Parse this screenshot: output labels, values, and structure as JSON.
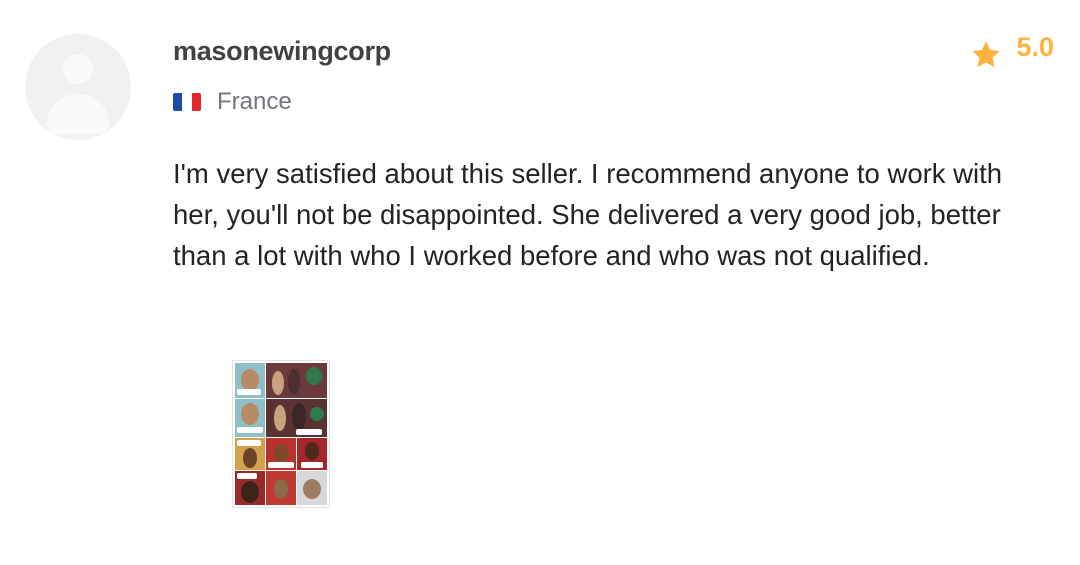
{
  "review": {
    "username": "masonewingcorp",
    "country": "France",
    "rating": "5.0",
    "text": "I'm very satisfied about this seller. I recommend anyone to work with her, you'll not be disappointed. She delivered a very good job, better than a lot with who I worked before and who was not qualified."
  },
  "icons": {
    "avatar": "user-placeholder-icon",
    "flag": "france-flag-icon",
    "star": "star-icon"
  },
  "colors": {
    "star": "#ffb33e",
    "username": "#404145",
    "muted": "#74767e",
    "flag_blue": "#1f4aa8",
    "flag_white": "#ffffff",
    "flag_red": "#e1262c"
  }
}
